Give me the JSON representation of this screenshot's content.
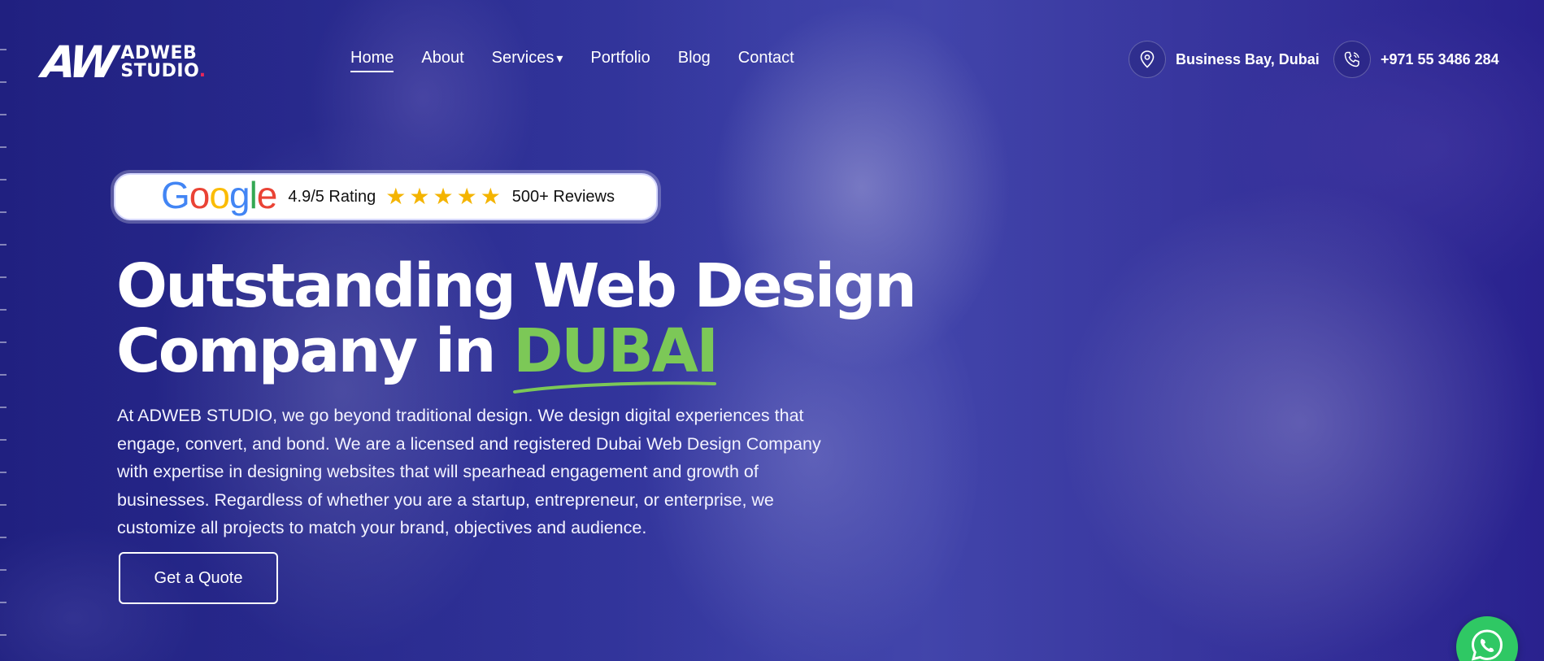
{
  "brand": {
    "mark": "AW",
    "name_line1": "ADWEB",
    "name_line2": "STUDIO",
    "dot": ".",
    "accent_color": "#e8265a"
  },
  "nav": {
    "items": [
      {
        "label": "Home",
        "active": true
      },
      {
        "label": "About"
      },
      {
        "label": "Services",
        "caret": "▾"
      },
      {
        "label": "Portfolio"
      },
      {
        "label": "Blog"
      },
      {
        "label": "Contact"
      }
    ]
  },
  "contact": {
    "location": {
      "icon": "map-pin-icon",
      "text": "Business Bay, Dubai"
    },
    "phone": {
      "icon": "phone-icon",
      "text": "+971 55 3486 284"
    }
  },
  "rating": {
    "google_letters": [
      "G",
      "o",
      "o",
      "g",
      "l",
      "e"
    ],
    "score": "4.9/5 Rating",
    "stars": 5,
    "reviews": "500+ Reviews"
  },
  "hero": {
    "title_line1": "Outstanding Web Design",
    "title_line2_prefix": "Company in ",
    "title_accent": "DUBAI",
    "accent_color": "#7cc857",
    "description": "At ADWEB STUDIO, we go beyond traditional design. We design digital experiences that engage, convert, and bond. We are a licensed and registered Dubai Web Design Company with expertise in designing websites that will spearhead engagement and growth of businesses. Regardless of whether you are a startup, entrepreneur, or enterprise, we customize all projects to match your brand, objectives and audience.",
    "cta_label": "Get a Quote"
  },
  "whatsapp": {
    "icon": "whatsapp-icon",
    "color": "#2fc864"
  }
}
